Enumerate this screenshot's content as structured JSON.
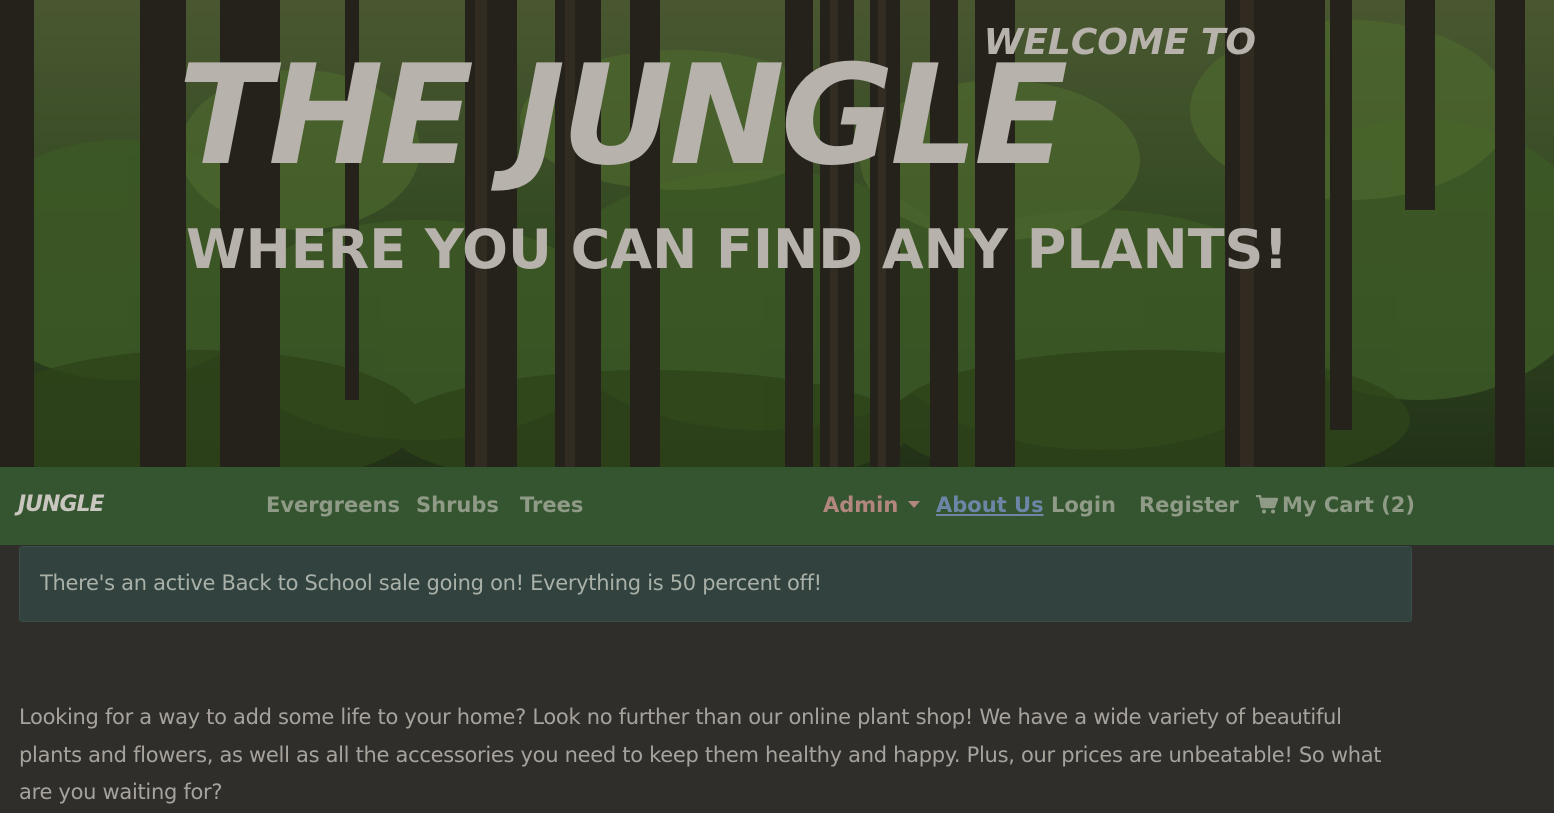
{
  "hero": {
    "welcome": "WELCOME TO",
    "title": "THE JUNGLE",
    "tagline": "WHERE YOU CAN FIND ANY PLANTS!"
  },
  "navbar": {
    "brand": "JUNGLE",
    "categories": [
      "Evergreens",
      "Shrubs",
      "Trees"
    ],
    "admin": "Admin",
    "about": "About Us",
    "login": "Login",
    "register": "Register",
    "cart_icon": "shopping-cart-icon",
    "cart": "My Cart (2)"
  },
  "alert": {
    "text": "There's an active Back to School sale going on! Everything is 50 percent off!"
  },
  "intro": {
    "text": "Looking for a way to add some life to your home? Look no further than our online plant shop! We have a wide variety of beautiful plants and flowers, as well as all the accessories you need to keep them healthy and happy. Plus, our prices are unbeatable! So what are you waiting for?"
  },
  "colors": {
    "navbar_bg": "#34552f",
    "page_bg": "#2f2e2b",
    "alert_bg": "#32423f",
    "admin_link": "#b3877d",
    "about_link": "#6d86a8"
  }
}
